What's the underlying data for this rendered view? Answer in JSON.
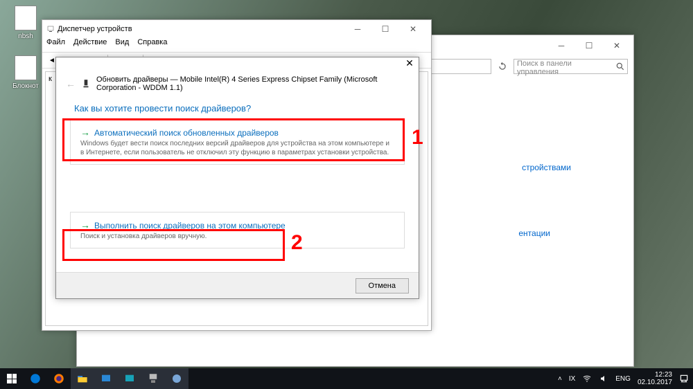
{
  "desktop": {
    "icons": [
      {
        "label": "nbsh"
      },
      {
        "label": "Блокнот"
      }
    ]
  },
  "controlPanel": {
    "searchPlaceholder": "Поиск в панели управления",
    "links": {
      "devices": "стройствами",
      "pres": "ентации"
    }
  },
  "deviceManager": {
    "title": "Диспетчер устройств",
    "menu": {
      "file": "Файл",
      "action": "Действие",
      "view": "Вид",
      "help": "Справка"
    },
    "tree": "к"
  },
  "wizard": {
    "header": "Обновить драйверы — Mobile Intel(R) 4 Series Express Chipset Family (Microsoft Corporation - WDDM 1.1)",
    "question": "Как вы хотите провести поиск драйверов?",
    "option1": {
      "title": "Автоматический поиск обновленных драйверов",
      "desc": "Windows будет вести поиск последних версий драйверов для устройства на этом компьютере и в Интернете, если пользователь не отключил эту функцию в параметрах установки устройства."
    },
    "option2": {
      "title": "Выполнить поиск драйверов на этом компьютере",
      "desc": "Поиск и установка драйверов вручную."
    },
    "cancel": "Отмена"
  },
  "annotations": {
    "one": "1",
    "two": "2"
  },
  "taskbar": {
    "tray": {
      "lang": "ENG",
      "time": "12:23",
      "date": "02.10.2017"
    }
  }
}
